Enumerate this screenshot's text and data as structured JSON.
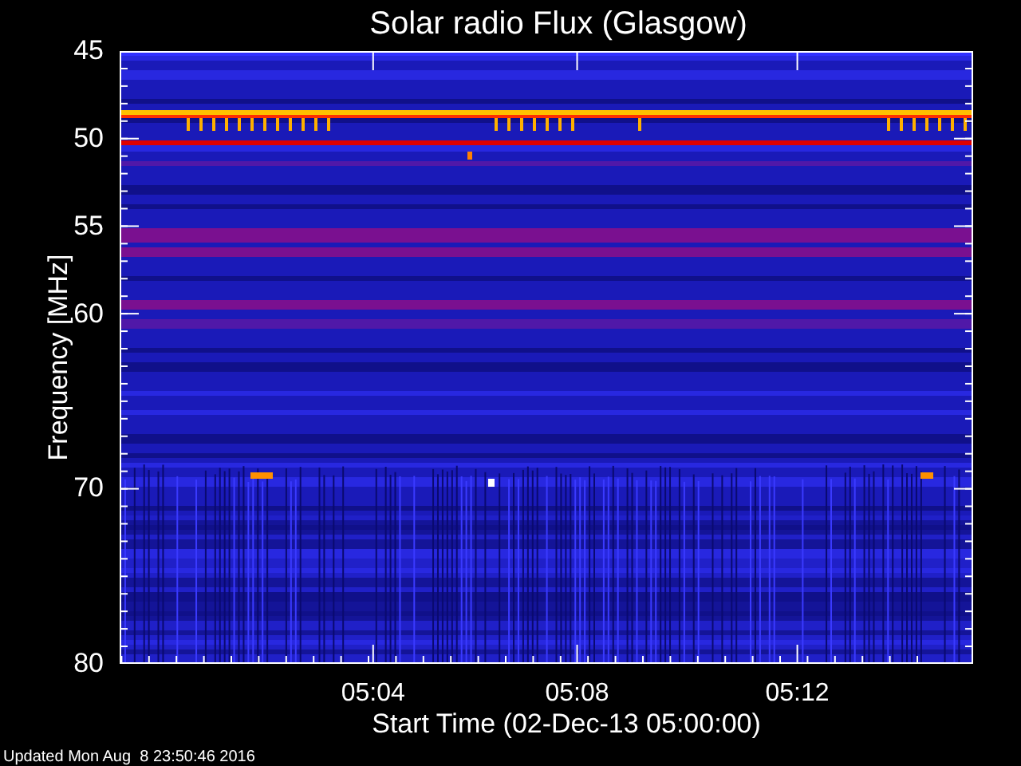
{
  "title": "Solar radio Flux (Glasgow)",
  "y_axis": {
    "label": "Frequency [MHz]",
    "ticks": [
      "45",
      "50",
      "55",
      "60",
      "70",
      "80"
    ]
  },
  "x_axis": {
    "label": "Start Time (02-Dec-13 05:00:00)",
    "ticks": [
      "05:04",
      "05:08",
      "05:12"
    ]
  },
  "footer": "Updated Mon Aug  8 23:50:46 2016"
}
